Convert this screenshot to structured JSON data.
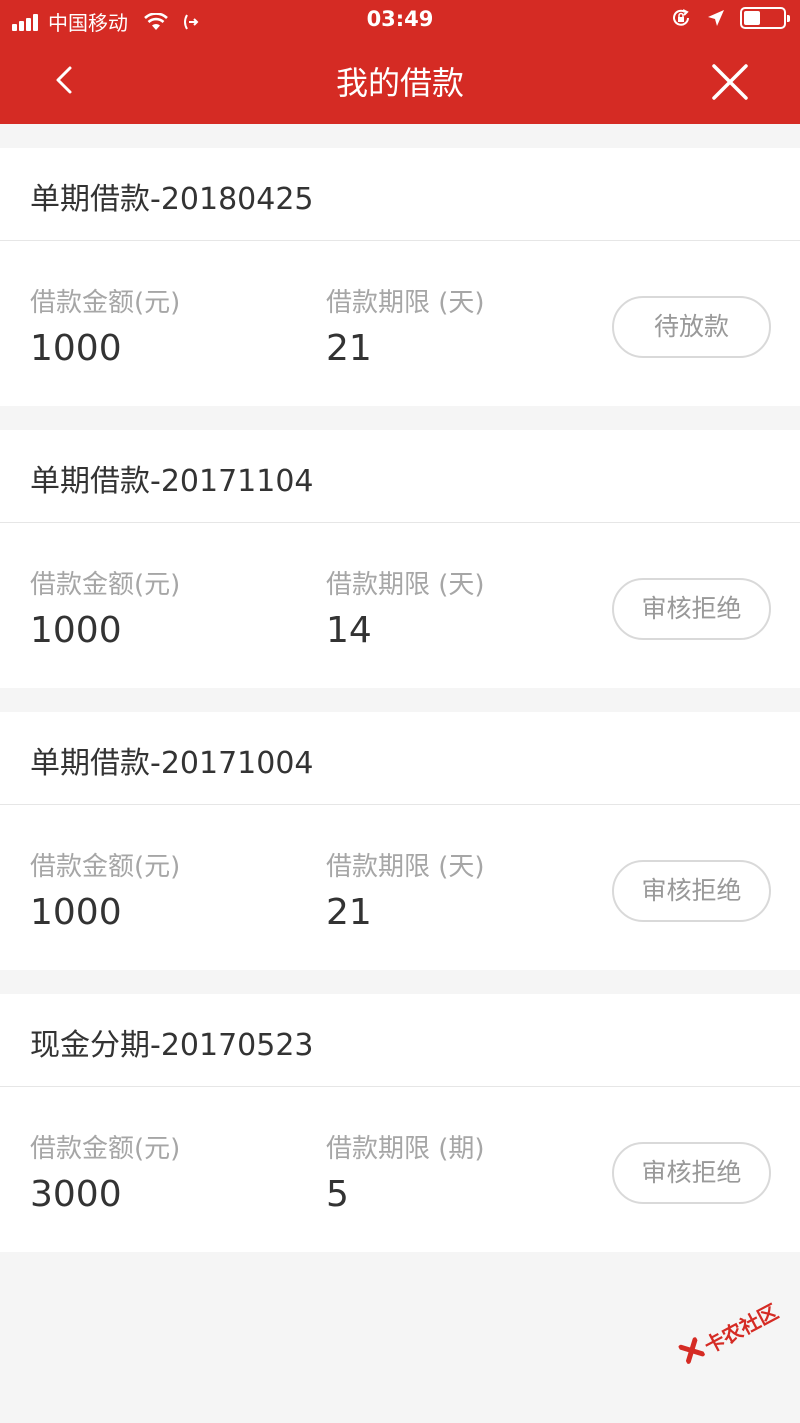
{
  "status_bar": {
    "carrier": "中国移动",
    "time": "03:49"
  },
  "nav": {
    "title": "我的借款",
    "back_icon": "chevron-left-icon",
    "close_icon": "close-icon"
  },
  "loans": [
    {
      "title": "单期借款-20180425",
      "amount_label": "借款金额(元)",
      "amount": "1000",
      "term_label": "借款期限 (天)",
      "term": "21",
      "status": "待放款"
    },
    {
      "title": "单期借款-20171104",
      "amount_label": "借款金额(元)",
      "amount": "1000",
      "term_label": "借款期限 (天)",
      "term": "14",
      "status": "审核拒绝"
    },
    {
      "title": "单期借款-20171004",
      "amount_label": "借款金额(元)",
      "amount": "1000",
      "term_label": "借款期限 (天)",
      "term": "21",
      "status": "审核拒绝"
    },
    {
      "title": "现金分期-20170523",
      "amount_label": "借款金额(元)",
      "amount": "3000",
      "term_label": "借款期限 (期)",
      "term": "5",
      "status": "审核拒绝"
    }
  ],
  "watermark": {
    "text": "卡农社区"
  },
  "colors": {
    "header": "#d52b24",
    "background": "#f5f5f5"
  }
}
